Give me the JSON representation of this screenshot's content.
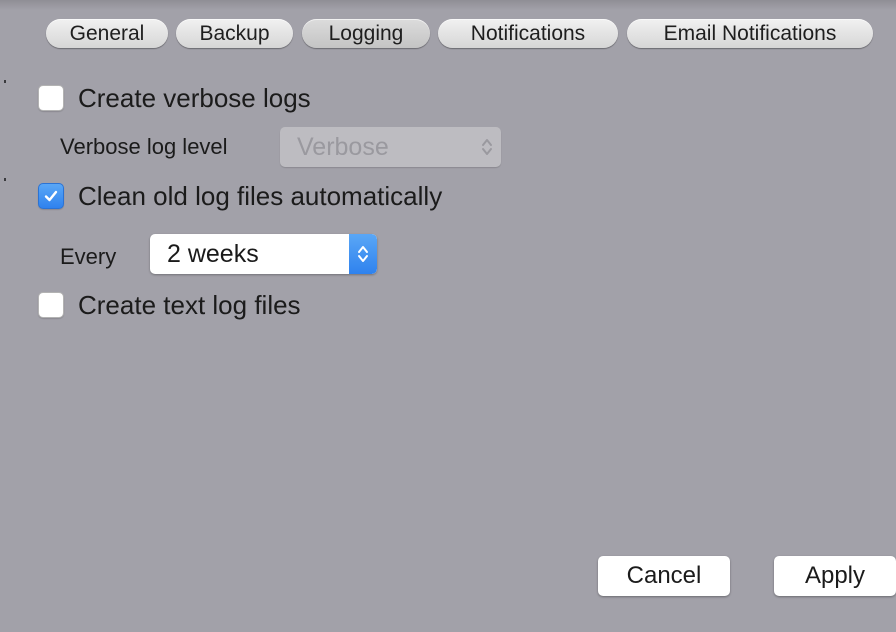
{
  "tabs": [
    {
      "label": "General"
    },
    {
      "label": "Backup"
    },
    {
      "label": "Logging"
    },
    {
      "label": "Notifications"
    },
    {
      "label": "Email Notifications"
    }
  ],
  "selected_tab": "Logging",
  "logging": {
    "verbose_logs": {
      "label": "Create verbose logs",
      "checked": false
    },
    "verbose_level": {
      "label": "Verbose log level",
      "value": "Verbose",
      "enabled": false
    },
    "clean_old_logs": {
      "label": "Clean old log files automatically",
      "checked": true
    },
    "clean_interval": {
      "label": "Every",
      "value": "2 weeks"
    },
    "text_logs": {
      "label": "Create text log files",
      "checked": false
    }
  },
  "buttons": {
    "cancel": "Cancel",
    "apply": "Apply"
  },
  "colors": {
    "window_background": "#a2a1a9",
    "accent": "#2f82ee"
  },
  "icons": {
    "checkmark": "checkmark-icon",
    "popup_stepper": "up-down-chevron-icon"
  }
}
